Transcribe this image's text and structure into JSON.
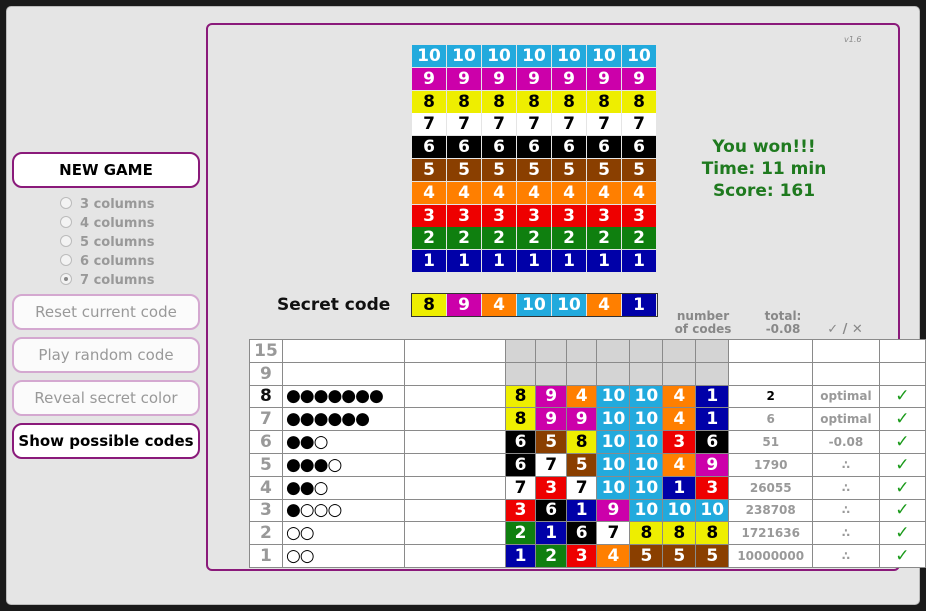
{
  "version": "v1.6",
  "sidebar": {
    "new_game": "NEW GAME",
    "column_options": [
      "3 columns",
      "4 columns",
      "5 columns",
      "6 columns",
      "7 columns"
    ],
    "selected_columns": "7 columns",
    "reset": "Reset current code",
    "play_random": "Play random code",
    "reveal": "Reveal secret color",
    "show_possible": "Show possible codes"
  },
  "palette": {
    "1": "#0000a8",
    "2": "#0f7f0f",
    "3": "#ee0000",
    "4": "#ff7f00",
    "5": "#8a3f00",
    "6": "#000000",
    "7": "#ffffff",
    "8": "#eeee00",
    "9": "#cc00aa",
    "10": "#22aadd"
  },
  "color_picker_rows": [
    "10",
    "9",
    "8",
    "7",
    "6",
    "5",
    "4",
    "3",
    "2",
    "1"
  ],
  "color_picker_columns": 7,
  "result": {
    "line1": "You won!!!",
    "line2": "Time: 11 min",
    "line3": "Score: 161"
  },
  "secret": {
    "label": "Secret code",
    "code": [
      "8",
      "9",
      "4",
      "10",
      "10",
      "4",
      "1"
    ]
  },
  "headers": {
    "number": "number",
    "of_codes": "of codes",
    "total": "total:",
    "total_value": "-0.08",
    "check": "✓ / ✕"
  },
  "attempts": [
    {
      "row": "15",
      "pegs": "",
      "code": [],
      "n": "",
      "total": "",
      "check": "",
      "current": false
    },
    {
      "row": "9",
      "pegs": "",
      "code": [],
      "n": "",
      "total": "",
      "check": "",
      "current": false
    },
    {
      "row": "8",
      "pegs": "●●●●●●●",
      "code": [
        "8",
        "9",
        "4",
        "10",
        "10",
        "4",
        "1"
      ],
      "n": "2",
      "total": "optimal",
      "check": "✓",
      "current": true
    },
    {
      "row": "7",
      "pegs": "●●●●●●",
      "code": [
        "8",
        "9",
        "9",
        "10",
        "10",
        "4",
        "1"
      ],
      "n": "6",
      "total": "optimal",
      "check": "✓",
      "current": false
    },
    {
      "row": "6",
      "pegs": "●●○",
      "code": [
        "6",
        "5",
        "8",
        "10",
        "10",
        "3",
        "6"
      ],
      "n": "51",
      "total": "-0.08",
      "check": "✓",
      "current": false
    },
    {
      "row": "5",
      "pegs": "●●●○",
      "code": [
        "6",
        "7",
        "5",
        "10",
        "10",
        "4",
        "9"
      ],
      "n": "1790",
      "total": "∴",
      "check": "✓",
      "current": false
    },
    {
      "row": "4",
      "pegs": "●●○",
      "code": [
        "7",
        "3",
        "7",
        "10",
        "10",
        "1",
        "3"
      ],
      "n": "26055",
      "total": "∴",
      "check": "✓",
      "current": false
    },
    {
      "row": "3",
      "pegs": "●○○○",
      "code": [
        "3",
        "6",
        "1",
        "9",
        "10",
        "10",
        "10"
      ],
      "n": "238708",
      "total": "∴",
      "check": "✓",
      "current": false
    },
    {
      "row": "2",
      "pegs": "○○",
      "code": [
        "2",
        "1",
        "6",
        "7",
        "8",
        "8",
        "8"
      ],
      "n": "1721636",
      "total": "∴",
      "check": "✓",
      "current": false
    },
    {
      "row": "1",
      "pegs": "○○",
      "code": [
        "1",
        "2",
        "3",
        "4",
        "5",
        "5",
        "5"
      ],
      "n": "10000000",
      "total": "∴",
      "check": "✓",
      "current": false
    }
  ]
}
